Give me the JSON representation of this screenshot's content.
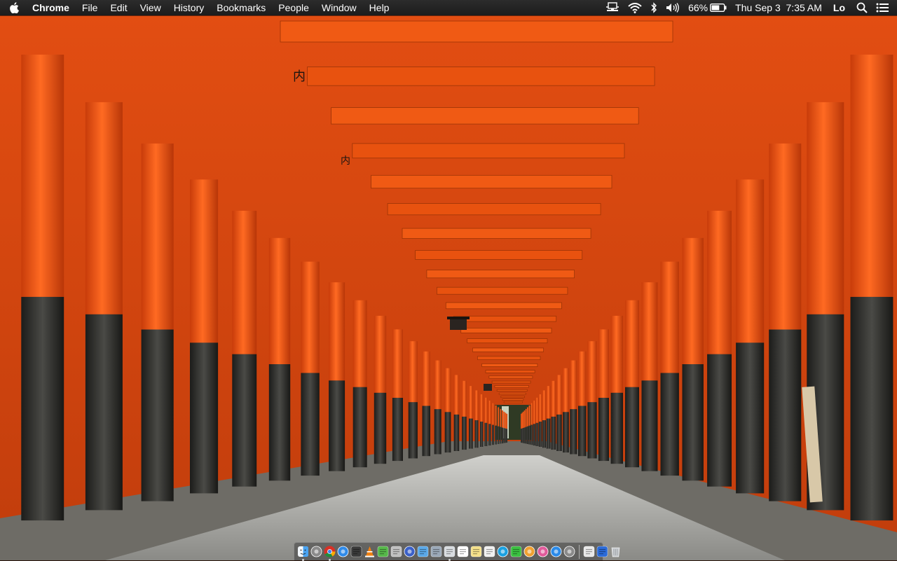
{
  "menubar": {
    "app_name": "Chrome",
    "menus": [
      "File",
      "Edit",
      "View",
      "History",
      "Bookmarks",
      "People",
      "Window",
      "Help"
    ],
    "status": {
      "battery_percent": "66%",
      "datetime": "Thu Sep 3  7:35 AM",
      "user": "Lo"
    },
    "icons": [
      "apple-icon",
      "airplay-icon",
      "wifi-icon",
      "bluetooth-icon",
      "volume-icon",
      "battery-icon",
      "spotlight-icon",
      "notification-center-icon"
    ]
  },
  "desktop": {
    "wallpaper": "Fushimi Inari torii gate tunnel",
    "gate_signs": [
      "内",
      "内"
    ],
    "colors": {
      "torii_orange": "#f05a14",
      "torii_black": "#2a2a28",
      "path": "#9a9a98"
    }
  },
  "dock": {
    "apps": [
      {
        "name": "Finder",
        "icon": "finder-icon",
        "running": true
      },
      {
        "name": "Launchpad",
        "icon": "launchpad-icon",
        "running": false
      },
      {
        "name": "Chrome",
        "icon": "chrome-icon",
        "running": true
      },
      {
        "name": "Safari",
        "icon": "safari-icon",
        "running": false
      },
      {
        "name": "Sublime",
        "icon": "sublime-icon",
        "running": false
      },
      {
        "name": "VLC",
        "icon": "vlc-icon",
        "running": false
      },
      {
        "name": "uTorrent",
        "icon": "utorrent-icon",
        "running": false
      },
      {
        "name": "Automator",
        "icon": "automator-icon",
        "running": false
      },
      {
        "name": "Browser",
        "icon": "globe-icon",
        "running": false
      },
      {
        "name": "Xcode",
        "icon": "xcode-icon",
        "running": false
      },
      {
        "name": "Preview",
        "icon": "preview-icon",
        "running": false
      },
      {
        "name": "Screenshot",
        "icon": "screenshot-icon",
        "running": true
      },
      {
        "name": "Calendar",
        "icon": "calendar-icon",
        "running": false
      },
      {
        "name": "Notes",
        "icon": "notes-icon",
        "running": false
      },
      {
        "name": "TextEdit",
        "icon": "textedit-icon",
        "running": false
      },
      {
        "name": "Skype",
        "icon": "skype-icon",
        "running": false
      },
      {
        "name": "Messages",
        "icon": "messages-icon",
        "running": false
      },
      {
        "name": "Photos",
        "icon": "photos-icon",
        "running": false
      },
      {
        "name": "iTunes",
        "icon": "itunes-icon",
        "running": false
      },
      {
        "name": "App Store",
        "icon": "appstore-icon",
        "running": false
      },
      {
        "name": "System Preferences",
        "icon": "preferences-icon",
        "running": false
      }
    ],
    "stacks": [
      {
        "name": "Documents",
        "icon": "documents-stack-icon"
      },
      {
        "name": "Downloads",
        "icon": "downloads-stack-icon"
      },
      {
        "name": "Trash",
        "icon": "trash-icon"
      }
    ]
  }
}
